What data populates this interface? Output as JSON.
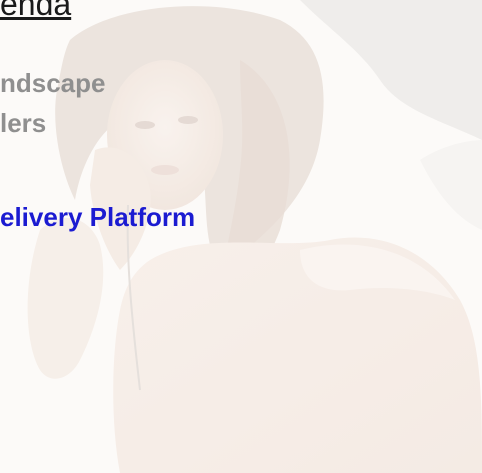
{
  "slide": {
    "title": "enda",
    "agenda_items": [
      {
        "text": "ndscape",
        "style": "muted"
      },
      {
        "text": "lers",
        "style": "muted"
      },
      {
        "text": "elivery Platform",
        "style": "accent"
      }
    ]
  },
  "colors": {
    "background": "#ffffff",
    "muted_text": "#8f8f8f",
    "accent_text": "#1b1bd1",
    "title_text": "#1a1a1a"
  }
}
